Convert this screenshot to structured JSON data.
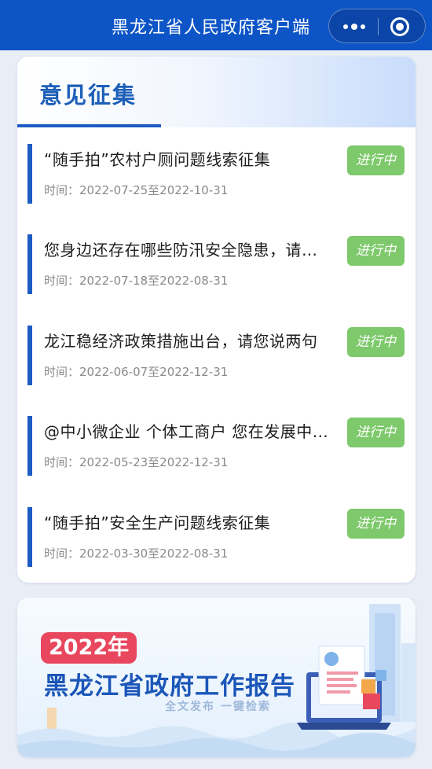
{
  "header": {
    "title": "黑龙江省人民政府客户端",
    "more_icon": "more-dots-icon",
    "close_icon": "close-circle-icon"
  },
  "section": {
    "title": "意见征集",
    "accent_color": "#1c5cc4"
  },
  "items": [
    {
      "title": "“随手拍”农村户厕问题线索征集",
      "time": "时间：2022-07-25至2022-10-31",
      "status": "进行中"
    },
    {
      "title": "您身边还存在哪些防汛安全隐患，请…",
      "time": "时间：2022-07-18至2022-08-31",
      "status": "进行中"
    },
    {
      "title": "龙江稳经济政策措施出台，请您说两句",
      "time": "时间：2022-06-07至2022-12-31",
      "status": "进行中"
    },
    {
      "title": "@中小微企业 个体工商户 您在发展中…",
      "time": "时间：2022-05-23至2022-12-31",
      "status": "进行中"
    },
    {
      "title": "“随手拍”安全生产问题线索征集",
      "time": "时间：2022-03-30至2022-08-31",
      "status": "进行中"
    }
  ],
  "status_color": "#7dc96b",
  "banner": {
    "year": "2022年",
    "title": "黑龙江省政府工作报告",
    "slogan": "全文发布 一键检索"
  }
}
